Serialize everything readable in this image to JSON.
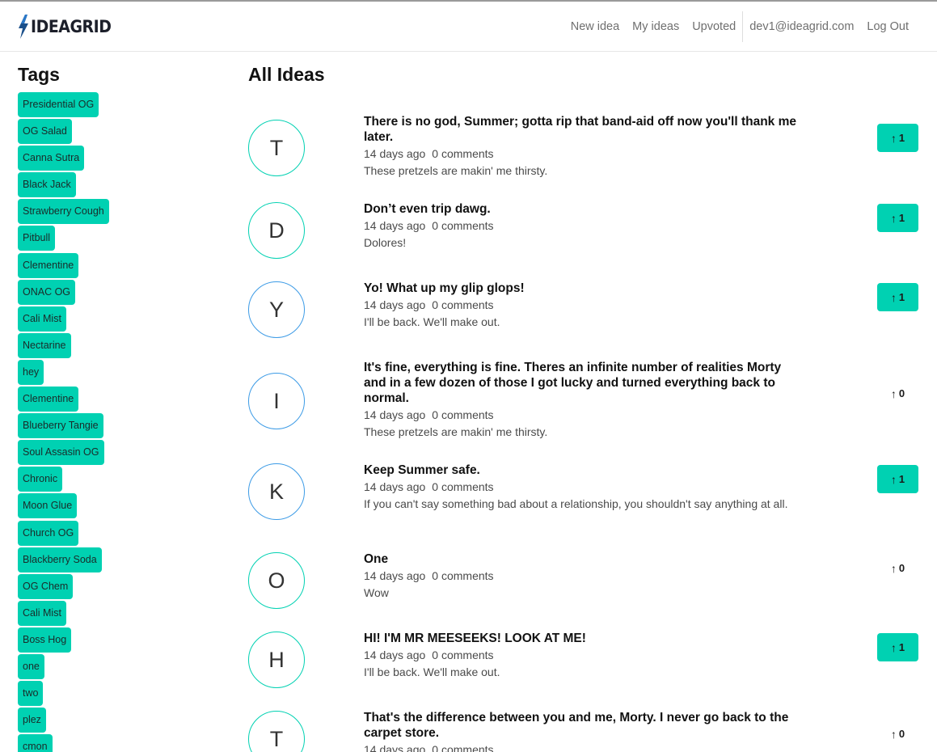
{
  "brand": {
    "name": "IDEAGRID"
  },
  "nav": {
    "new_idea": "New idea",
    "my_ideas": "My ideas",
    "upvoted": "Upvoted",
    "user_email": "dev1@ideagrid.com",
    "log_out": "Log Out"
  },
  "colors": {
    "accent": "#00d1b2",
    "avatar_alt_border": "#3c9be6"
  },
  "tags": {
    "title": "Tags",
    "items": [
      "Presidential OG",
      "OG Salad",
      "Canna Sutra",
      "Black Jack",
      "Strawberry Cough",
      "Pitbull",
      "Clementine",
      "ONAC OG",
      "Cali Mist",
      "Nectarine",
      "hey",
      "Clementine",
      "Blueberry Tangie",
      "Soul Assasin OG",
      "Chronic",
      "Moon Glue",
      "Church OG",
      "Blackberry Soda",
      "OG Chem",
      "Cali Mist",
      "Boss Hog",
      "one",
      "two",
      "plez",
      "cmon"
    ]
  },
  "main": {
    "title": "All Ideas",
    "ideas": [
      {
        "initial": "T",
        "title": "There is no god, Summer; gotta rip that band-aid off now you'll thank me later.",
        "age": "14 days ago",
        "comments": "0 comments",
        "body": "These pretzels are makin' me thirsty.",
        "votes": "1",
        "upvoted": true,
        "avatar_border": "accent"
      },
      {
        "initial": "D",
        "title": "Don’t even trip dawg.",
        "age": "14 days ago",
        "comments": "0 comments",
        "body": "Dolores!",
        "votes": "1",
        "upvoted": true,
        "avatar_border": "accent"
      },
      {
        "initial": "Y",
        "title": "Yo! What up my glip glops!",
        "age": "14 days ago",
        "comments": "0 comments",
        "body": "I'll be back. We'll make out.",
        "votes": "1",
        "upvoted": true,
        "avatar_border": "alt"
      },
      {
        "initial": "I",
        "title": "It's fine, everything is fine. Theres an infinite number of realities Morty and in a few dozen of those I got lucky and turned everything back to normal.",
        "age": "14 days ago",
        "comments": "0 comments",
        "body": "These pretzels are makin' me thirsty.",
        "votes": "0",
        "upvoted": false,
        "avatar_border": "alt"
      },
      {
        "initial": "K",
        "title": "Keep Summer safe.",
        "age": "14 days ago",
        "comments": "0 comments",
        "body": "If you can't say something bad about a relationship, you shouldn't say anything at all.",
        "votes": "1",
        "upvoted": true,
        "avatar_border": "alt"
      },
      {
        "initial": "O",
        "title": "One",
        "age": "14 days ago",
        "comments": "0 comments",
        "body": "Wow",
        "votes": "0",
        "upvoted": false,
        "avatar_border": "accent"
      },
      {
        "initial": "H",
        "title": "HI! I'M MR MEESEEKS! LOOK AT ME!",
        "age": "14 days ago",
        "comments": "0 comments",
        "body": "I'll be back. We'll make out.",
        "votes": "1",
        "upvoted": true,
        "avatar_border": "accent"
      },
      {
        "initial": "T",
        "title": "That's the difference between you and me, Morty. I never go back to the carpet store.",
        "age": "14 days ago",
        "comments": "0 comments",
        "body": "",
        "votes": "0",
        "upvoted": false,
        "avatar_border": "accent"
      }
    ]
  }
}
